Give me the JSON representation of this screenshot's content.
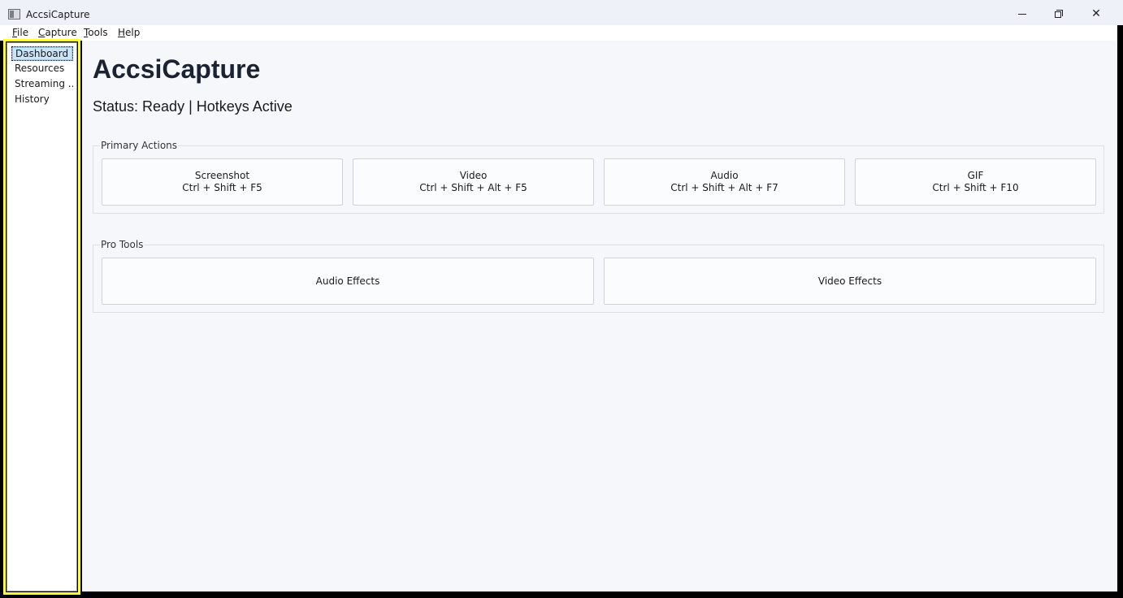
{
  "window": {
    "title": "AccsiCapture"
  },
  "menu": {
    "items": [
      {
        "accel": "F",
        "rest": "ile"
      },
      {
        "accel": "C",
        "rest": "apture"
      },
      {
        "accel": "T",
        "rest": "ools"
      },
      {
        "accel": "H",
        "rest": "elp"
      }
    ]
  },
  "sidebar": {
    "items": [
      "Dashboard",
      "Resources",
      "Streaming ...",
      "History"
    ],
    "selected": "Dashboard"
  },
  "main": {
    "title": "AccsiCapture",
    "status": "Status: Ready | Hotkeys Active"
  },
  "primary_actions": {
    "legend": "Primary Actions",
    "buttons": [
      {
        "label": "Screenshot",
        "hotkey": "Ctrl + Shift + F5"
      },
      {
        "label": "Video",
        "hotkey": "Ctrl + Shift + Alt + F5"
      },
      {
        "label": "Audio",
        "hotkey": "Ctrl + Shift + Alt + F7"
      },
      {
        "label": "GIF",
        "hotkey": "Ctrl + Shift + F10"
      }
    ]
  },
  "pro_tools": {
    "legend": "Pro Tools",
    "buttons": [
      {
        "label": "Audio Effects"
      },
      {
        "label": "Video Effects"
      }
    ]
  },
  "colors": {
    "accent_highlight": "#ffff3a",
    "selection": "#cce4f7",
    "background": "#f5f7fa"
  }
}
